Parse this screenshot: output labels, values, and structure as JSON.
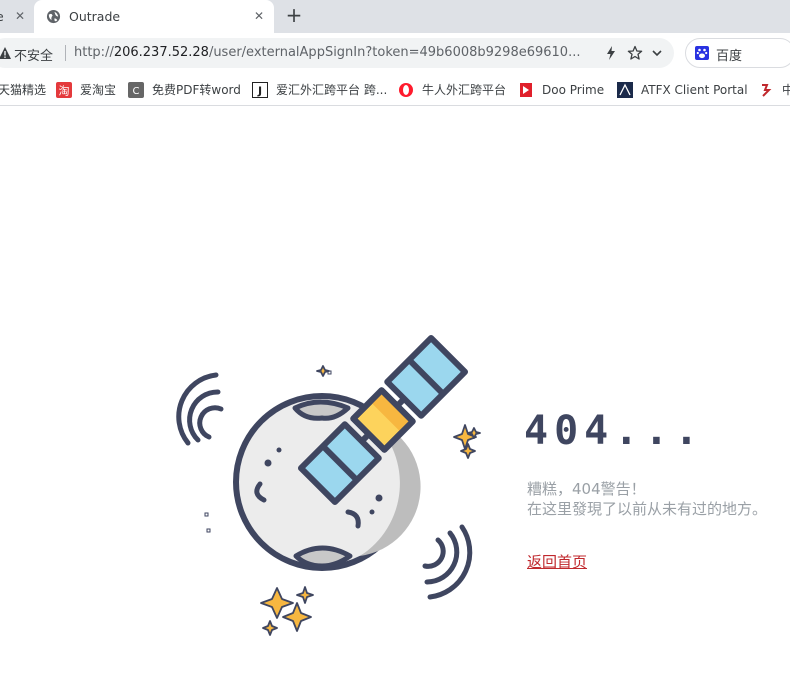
{
  "tabs": [
    {
      "title": "e",
      "close": "✕"
    },
    {
      "title": "Outrade",
      "close": "✕"
    }
  ],
  "new_tab_label": "+",
  "omnibox": {
    "security_label": "不安全",
    "url_scheme": "http://",
    "url_host": "206.237.52.28",
    "url_path": "/user/externalAppSignIn?token=49b6008b9298e69610..."
  },
  "search": {
    "label": "百度"
  },
  "bookmarks": [
    {
      "label": "天猫精选",
      "icon": "tmall-icon",
      "color": "#ff0036"
    },
    {
      "label": "爱淘宝",
      "icon": "taobao-icon",
      "color": "#e4393c"
    },
    {
      "label": "免费PDF转word",
      "icon": "c-icon",
      "color": "#666666"
    },
    {
      "label": "爱汇外汇跨平台 跨...",
      "icon": "j-icon",
      "color": "#222222"
    },
    {
      "label": "牛人外汇跨平台",
      "icon": "opera-icon",
      "color": "#ff1b2d"
    },
    {
      "label": "Doo Prime",
      "icon": "doo-icon",
      "color": "#e0202b"
    },
    {
      "label": "ATFX Client Portal",
      "icon": "atfx-icon",
      "color": "#1b2a4a"
    },
    {
      "label": "中",
      "icon": "zh-icon",
      "color": "#c0282d"
    }
  ],
  "error": {
    "title": "404...",
    "line1": "糟糕，404警告！",
    "line2": "在这里發現了以前从未有过的地方。",
    "home_link": "返回首页"
  },
  "colors": {
    "accent_red": "#c0282d",
    "illustration_dark": "#3f4660",
    "panel_blue": "#9bd7ee",
    "body_yellow": "#fdd35c",
    "star_gold": "#f7b740"
  }
}
